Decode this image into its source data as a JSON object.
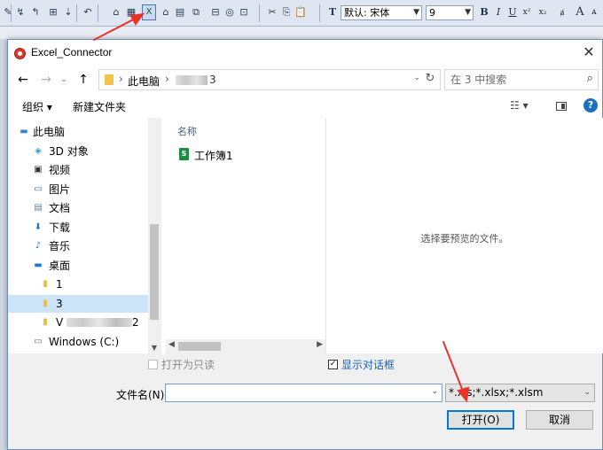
{
  "app_toolbar": {
    "font_name": "默认: 宋体",
    "font_size": "9",
    "format_buttons": [
      "B",
      "I",
      "U",
      "x²",
      "x₂",
      "ⱥ",
      "A"
    ]
  },
  "dialog": {
    "title": "Excel_Connector",
    "address": {
      "crumb_root": "此电脑",
      "crumb_last": "3"
    },
    "search": {
      "placeholder": "在 3 中搜索"
    },
    "commands": {
      "organize": "组织 ▾",
      "new_folder": "新建文件夹"
    },
    "nav_items": [
      {
        "label": "此电脑",
        "icon": "computer-icon"
      },
      {
        "label": "3D 对象",
        "icon": "3d-objects-icon"
      },
      {
        "label": "视频",
        "icon": "video-icon"
      },
      {
        "label": "图片",
        "icon": "pictures-icon"
      },
      {
        "label": "文档",
        "icon": "documents-icon"
      },
      {
        "label": "下载",
        "icon": "download-icon"
      },
      {
        "label": "音乐",
        "icon": "music-icon"
      },
      {
        "label": "桌面",
        "icon": "desktop-icon"
      },
      {
        "label": "1",
        "icon": "folder-icon"
      },
      {
        "label": "3",
        "icon": "folder-icon",
        "selected": true
      },
      {
        "label": "V",
        "suffix": "2",
        "icon": "folder-icon"
      },
      {
        "label": "Windows (C:)",
        "icon": "drive-icon"
      }
    ],
    "file_list": {
      "column_name": "名称",
      "files": [
        {
          "label": "工作簿1",
          "icon": "excel-sheet-icon"
        }
      ]
    },
    "preview_text": "选择要预览的文件。",
    "options": {
      "open_readonly": "打开为只读",
      "show_dialog": "显示对话框",
      "show_dialog_checked": true
    },
    "filename_label": "文件名(N):",
    "filename_value": "",
    "filetype_value": "*.xls;*.xlsx;*.xlsm",
    "open_button": "打开(O)",
    "cancel_button": "取消"
  },
  "colors": {
    "accent_blue": "#0078d7",
    "annotation_red": "#e8322a",
    "selection": "#cce4f7"
  }
}
